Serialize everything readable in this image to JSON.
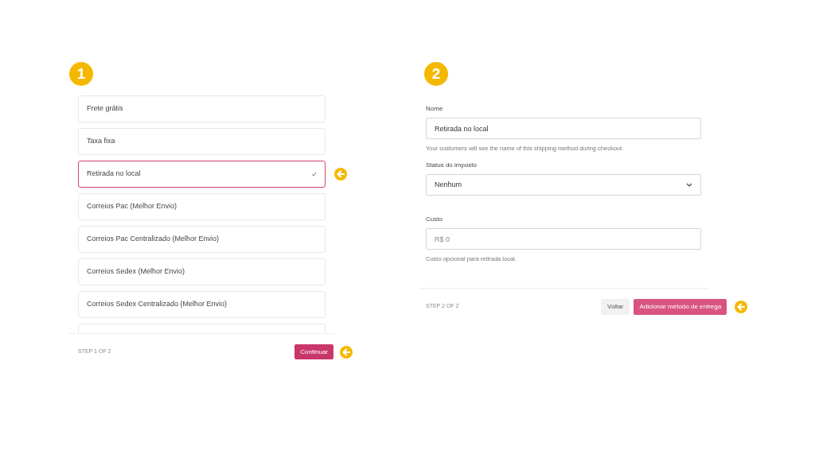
{
  "step_1": {
    "badge": "1",
    "options": [
      {
        "label": "Frete grátis",
        "selected": false
      },
      {
        "label": "Taxa fixa",
        "selected": false
      },
      {
        "label": "Retirada no local",
        "selected": true
      },
      {
        "label": "Correios Pac (Melhor Envio)",
        "selected": false
      },
      {
        "label": "Correios Pac Centralizado (Melhor Envio)",
        "selected": false
      },
      {
        "label": "Correios Sedex (Melhor Envio)",
        "selected": false
      },
      {
        "label": "Correios Sedex Centralizado (Melhor Envio)",
        "selected": false
      }
    ],
    "step_label": "STEP 1 OF 2",
    "continue_button": "Continuar"
  },
  "step_2": {
    "badge": "2",
    "fields": [
      {
        "kind": "text",
        "label": "Nome",
        "value": "Retirada no local",
        "help": "Your customers will see the name of this shipping method during checkout."
      },
      {
        "kind": "select",
        "label": "Status do imposto",
        "value": "Nenhum"
      },
      {
        "kind": "text",
        "label": "Custo",
        "placeholder": "R$ 0",
        "help": "Custo opcional para retirada local."
      }
    ],
    "step_label": "STEP 2 OF 2",
    "back_button": "Voltar",
    "add_button": "Adicionar método de entrega"
  }
}
